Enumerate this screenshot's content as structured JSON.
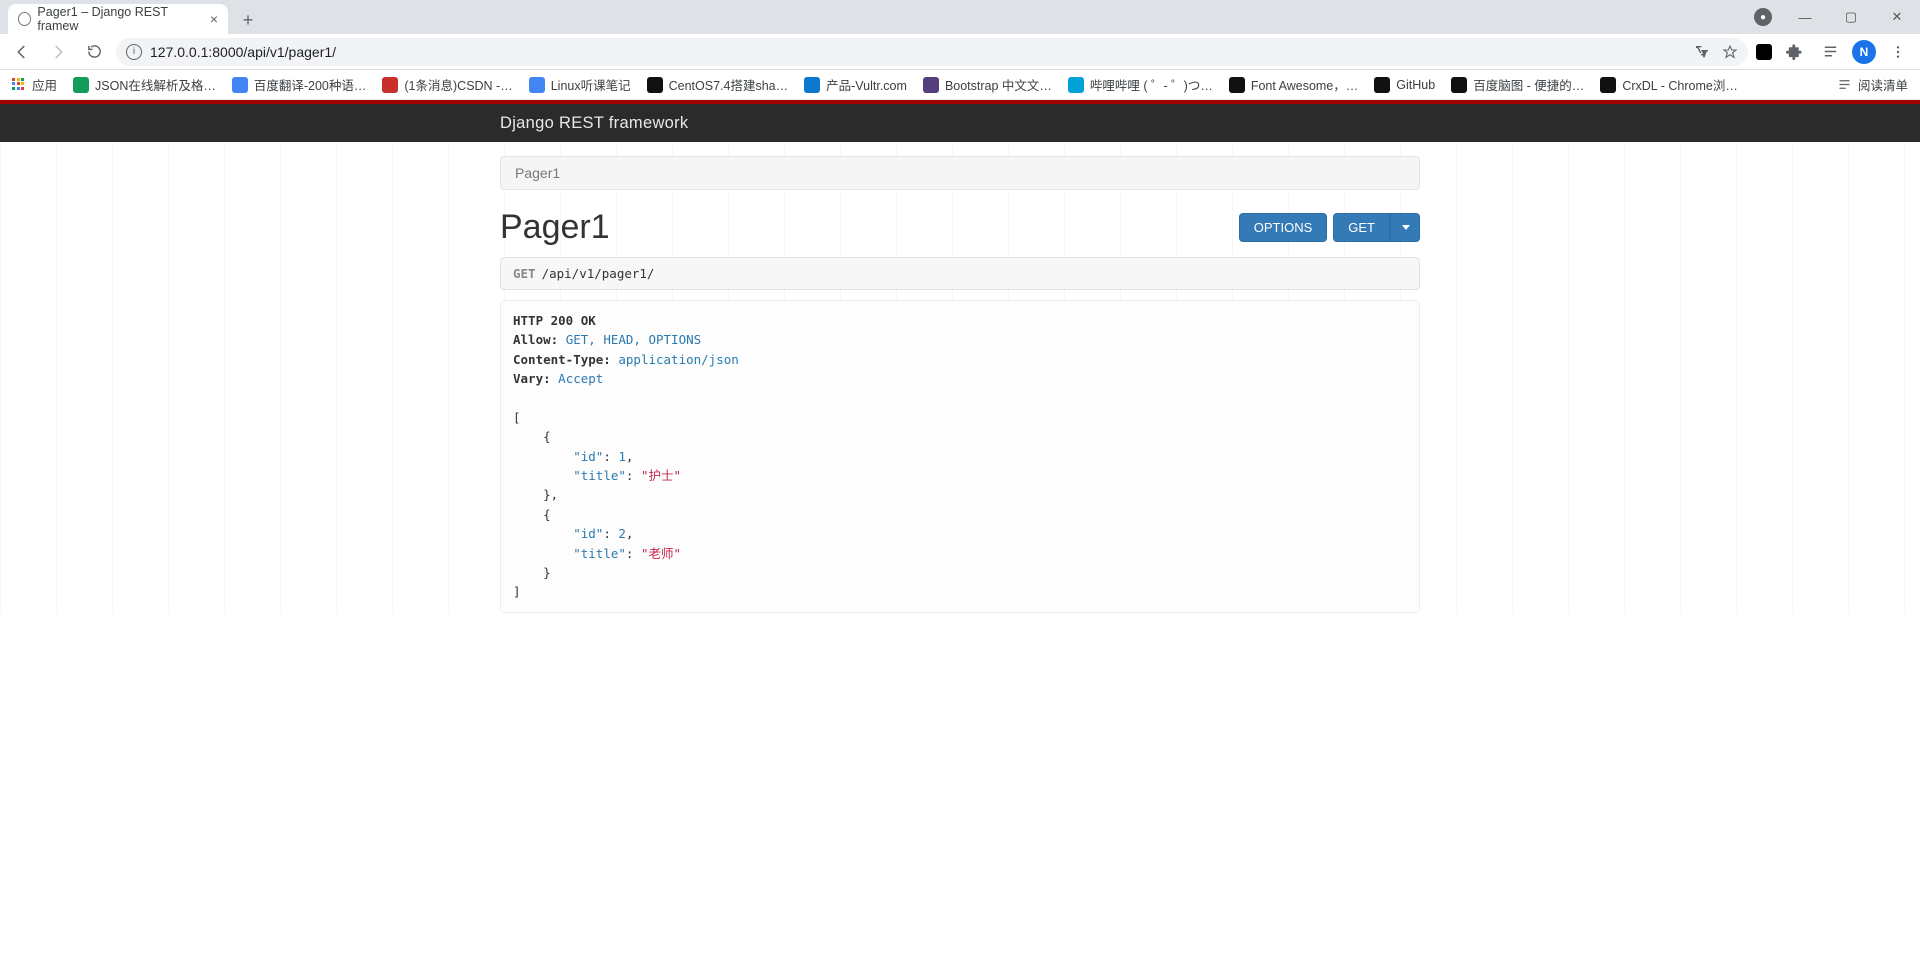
{
  "browser": {
    "tab_title": "Pager1 – Django REST framew",
    "url": "127.0.0.1:8000/api/v1/pager1/",
    "avatar_letter": "N"
  },
  "bookmarks": {
    "apps_label": "应用",
    "items": [
      {
        "label": "JSON在线解析及格…",
        "bg": "#0f9d58"
      },
      {
        "label": "百度翻译-200种语…",
        "bg": "#4285f4"
      },
      {
        "label": "(1条消息)CSDN -…",
        "bg": "#c9302c"
      },
      {
        "label": "Linux听课笔记",
        "bg": "#4285f4"
      },
      {
        "label": "CentOS7.4搭建sha…",
        "bg": "#111"
      },
      {
        "label": "产品-Vultr.com",
        "bg": "#0b79d0"
      },
      {
        "label": "Bootstrap 中文文…",
        "bg": "#563d7c"
      },
      {
        "label": "哔哩哔哩 ( ゜- ゜)つ…",
        "bg": "#00a1d6"
      },
      {
        "label": "Font Awesome，…",
        "bg": "#111"
      },
      {
        "label": "GitHub",
        "bg": "#111"
      },
      {
        "label": "百度脑图 - 便捷的…",
        "bg": "#111"
      },
      {
        "label": "CrxDL - Chrome浏…",
        "bg": "#111"
      }
    ],
    "reading_list": "阅读清单"
  },
  "drf": {
    "brand": "Django REST framework",
    "breadcrumb": "Pager1",
    "title": "Pager1",
    "options_btn": "OPTIONS",
    "get_btn": "GET",
    "request": {
      "method": "GET",
      "path": "/api/v1/pager1/"
    },
    "response": {
      "status": "HTTP 200 OK",
      "headers": {
        "Allow": "GET, HEAD, OPTIONS",
        "Content-Type": "application/json",
        "Vary": "Accept"
      },
      "body": [
        {
          "id": 1,
          "title": "护士"
        },
        {
          "id": 2,
          "title": "老师"
        }
      ]
    }
  }
}
